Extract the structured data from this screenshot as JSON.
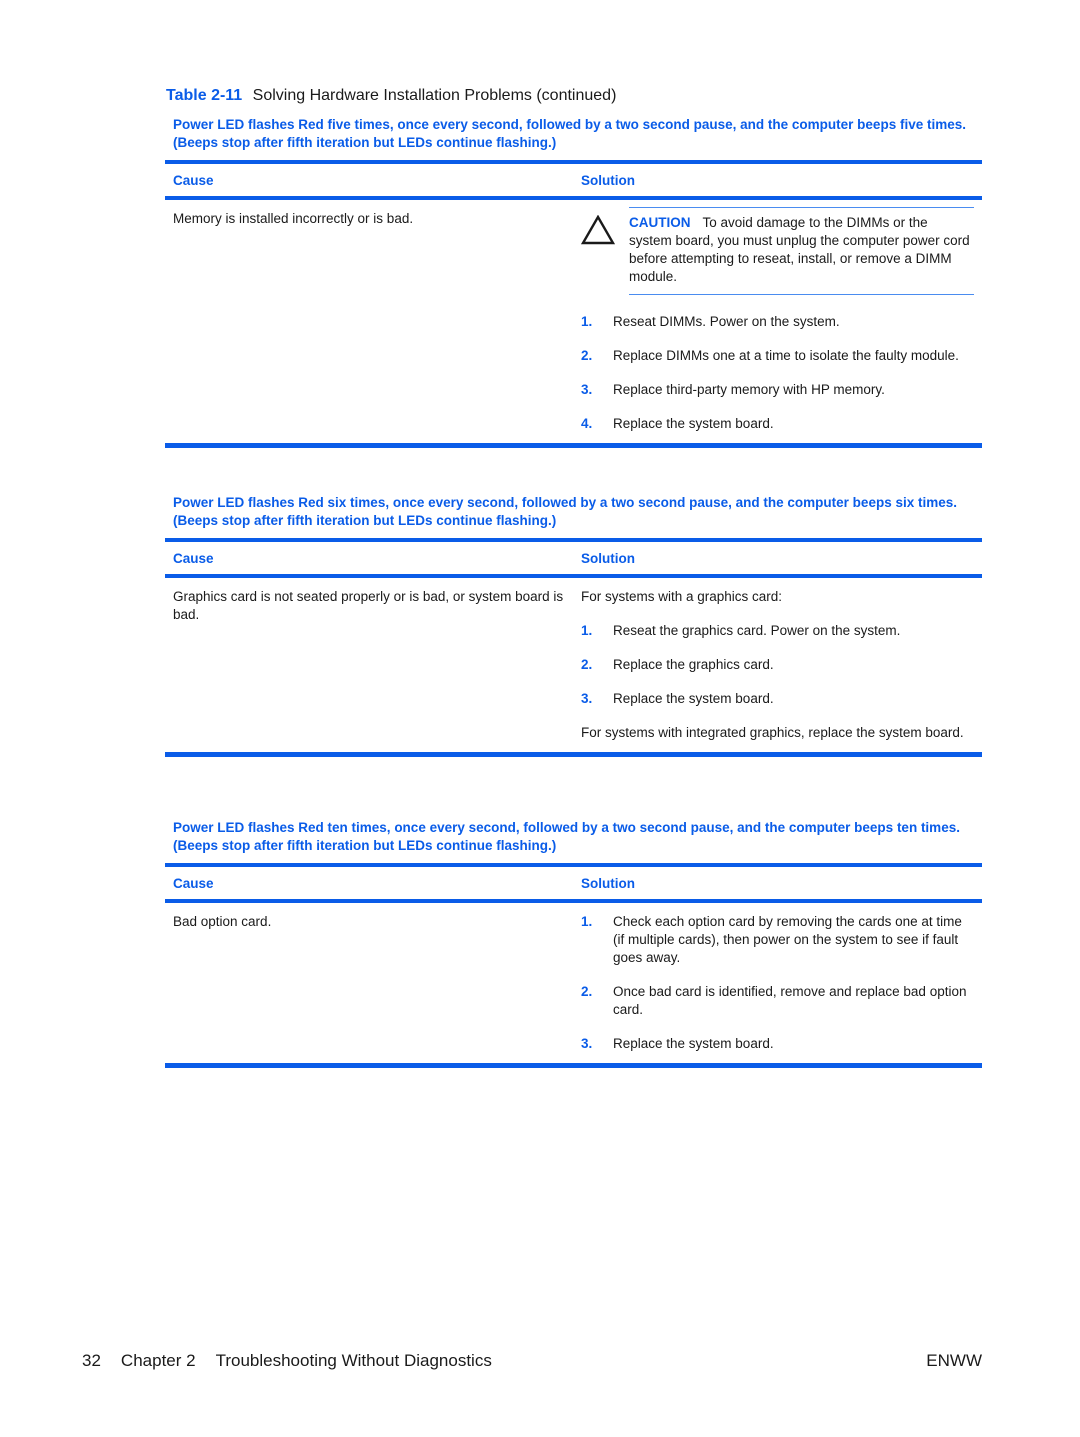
{
  "caption": {
    "label": "Table",
    "number": "2-11",
    "title": "Solving Hardware Installation Problems (continued)"
  },
  "colors": {
    "accent": "#0a5ce8"
  },
  "sections": [
    {
      "title": "Power LED flashes Red five times, once every second, followed by a two second pause, and the computer beeps five times. (Beeps stop after fifth iteration but LEDs continue flashing.)",
      "cause_header": "Cause",
      "solution_header": "Solution",
      "cause": "Memory is installed incorrectly or is bad.",
      "caution": {
        "icon": "warning-triangle-icon",
        "label": "CAUTION",
        "text": "To avoid damage to the DIMMs or the system board, you must unplug the computer power cord before attempting to reseat, install, or remove a DIMM module."
      },
      "steps": [
        {
          "num": "1.",
          "text": "Reseat DIMMs. Power on the system."
        },
        {
          "num": "2.",
          "text": "Replace DIMMs one at a time to isolate the faulty module."
        },
        {
          "num": "3.",
          "text": "Replace third-party memory with HP memory."
        },
        {
          "num": "4.",
          "text": "Replace the system board."
        }
      ]
    },
    {
      "title": "Power LED flashes Red six times, once every second, followed by a two second pause, and the computer beeps six times. (Beeps stop after fifth iteration but LEDs continue flashing.)",
      "cause_header": "Cause",
      "solution_header": "Solution",
      "cause": "Graphics card is not seated properly or is bad, or system board is bad.",
      "intro": "For systems with a graphics card:",
      "steps": [
        {
          "num": "1.",
          "text": "Reseat the graphics card. Power on the system."
        },
        {
          "num": "2.",
          "text": "Replace the graphics card."
        },
        {
          "num": "3.",
          "text": "Replace the system board."
        }
      ],
      "outro": "For systems with integrated graphics, replace the system board."
    },
    {
      "title": "Power LED flashes Red ten times, once every second, followed by a two second pause, and the computer beeps ten times. (Beeps stop after fifth iteration but LEDs continue flashing.)",
      "cause_header": "Cause",
      "solution_header": "Solution",
      "cause": "Bad option card.",
      "steps": [
        {
          "num": "1.",
          "text": "Check each option card by removing the cards one at time (if multiple cards), then power on the system to see if fault goes away."
        },
        {
          "num": "2.",
          "text": "Once bad card is identified, remove and replace bad option card."
        },
        {
          "num": "3.",
          "text": "Replace the system board."
        }
      ]
    }
  ],
  "footer": {
    "page_number": "32",
    "chapter": "Chapter 2",
    "chapter_title": "Troubleshooting Without Diagnostics",
    "locale": "ENWW"
  }
}
